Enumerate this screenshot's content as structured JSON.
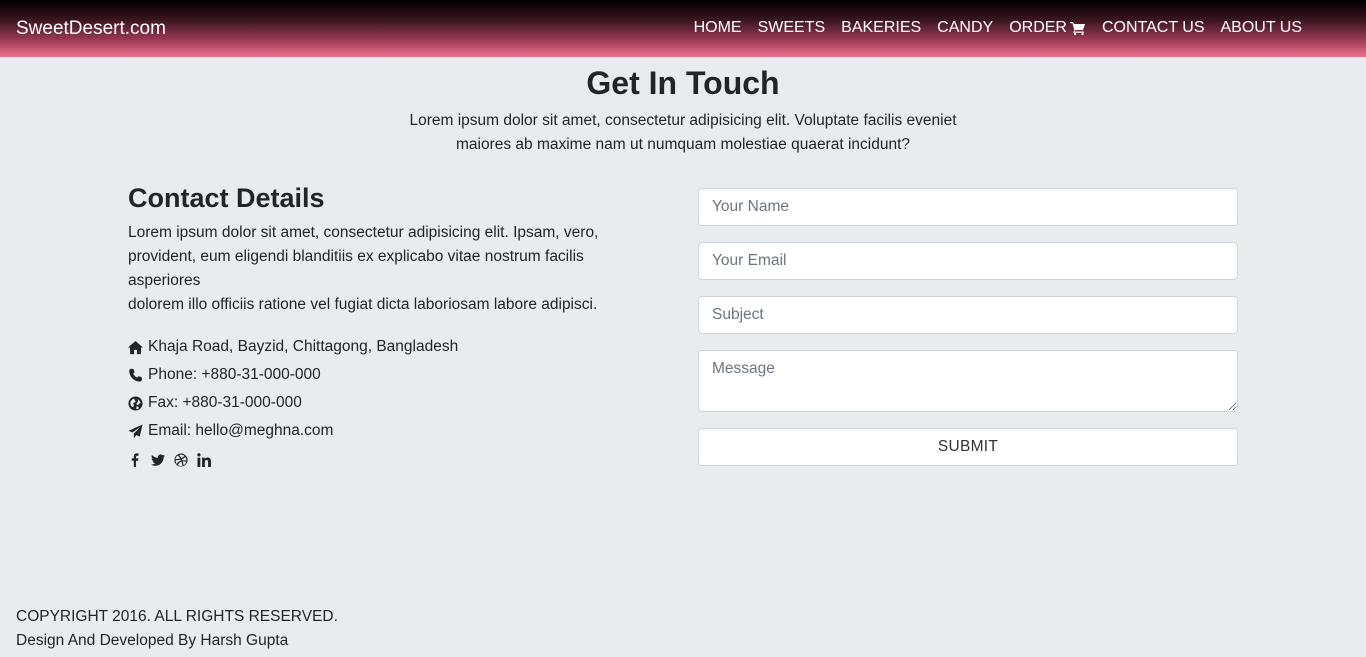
{
  "nav": {
    "brand": "SweetDesert.com",
    "items": [
      "HOME",
      "SWEETS",
      "BAKERIES",
      "CANDY",
      "ORDER",
      "CONTACT US",
      "ABOUT US"
    ]
  },
  "header": {
    "title": "Get In Touch",
    "intro_line1": "Lorem ipsum dolor sit amet, consectetur adipisicing elit. Voluptate facilis eveniet",
    "intro_line2": "maiores ab maxime nam ut numquam molestiae quaerat incidunt?"
  },
  "details": {
    "title": "Contact Details",
    "text_line1": "Lorem ipsum dolor sit amet, consectetur adipisicing elit. Ipsam, vero,",
    "text_line2": "provident, eum eligendi blanditiis ex explicabo vitae nostrum facilis",
    "text_line3": "asperiores",
    "text_line4": "dolorem illo officiis ratione vel fugiat dicta laboriosam labore adipisci.",
    "address": "Khaja Road, Bayzid, Chittagong, Bangladesh",
    "phone": "Phone: +880-31-000-000",
    "fax": "Fax: +880-31-000-000",
    "email": "Email: hello@meghna.com",
    "icons": [
      "home-icon",
      "phone-icon",
      "globe-icon",
      "paper-plane-icon"
    ],
    "social": [
      "facebook-icon",
      "twitter-icon",
      "dribbble-icon",
      "linkedin-icon"
    ]
  },
  "form": {
    "name_placeholder": "Your Name",
    "email_placeholder": "Your Email",
    "subject_placeholder": "Subject",
    "message_placeholder": "Message",
    "submit_label": "SUBMIT"
  },
  "footer": {
    "copyright": "COPYRIGHT 2016. ALL RIGHTS RESERVED.",
    "credit": "Design And Developed By Harsh Gupta"
  },
  "colors": {
    "page_bg": "#e8ecef",
    "nav_gradient_top": "#000000",
    "nav_gradient_bottom": "#f07090",
    "text": "#212529"
  }
}
